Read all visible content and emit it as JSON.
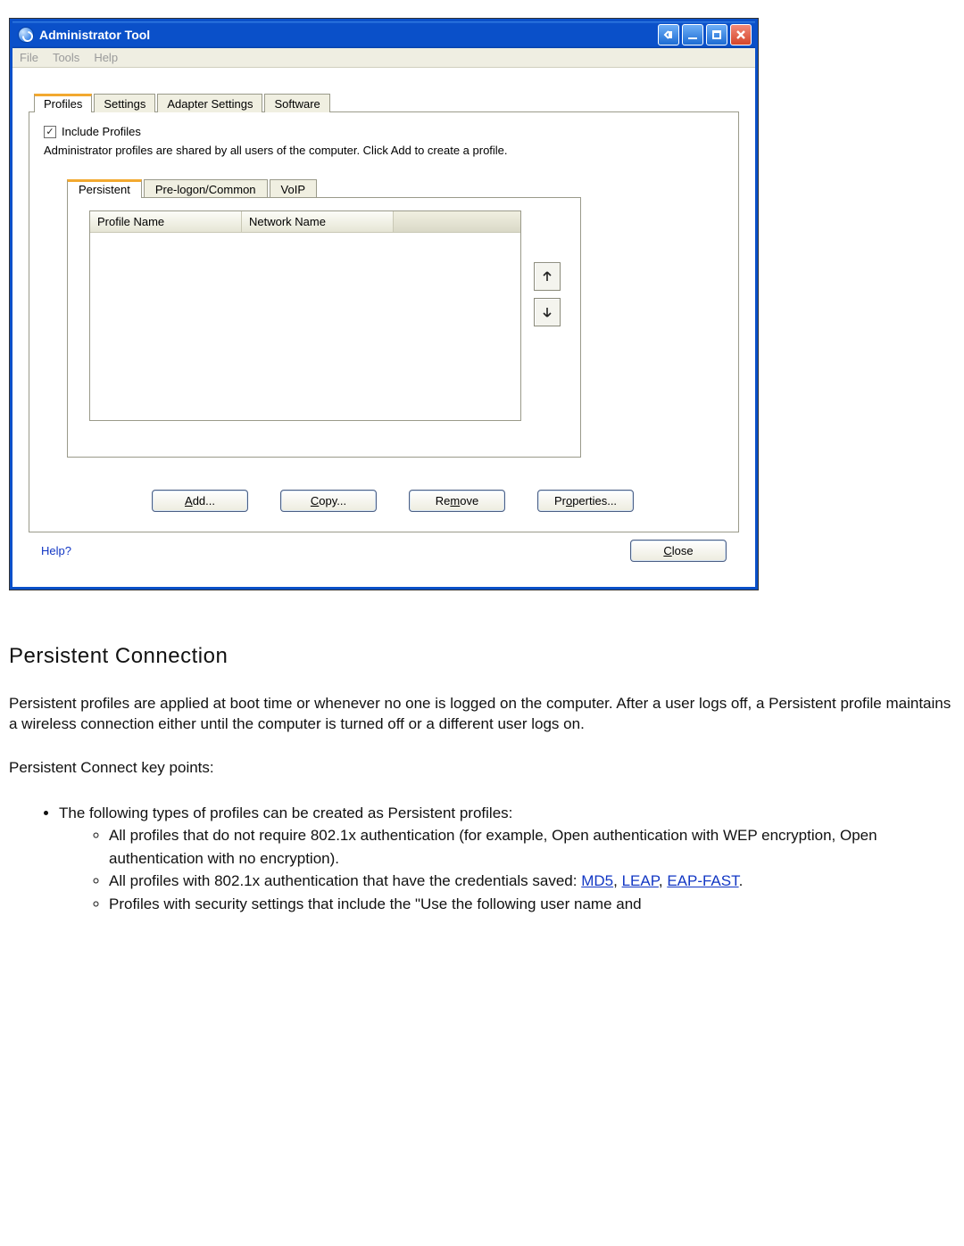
{
  "window": {
    "title": "Administrator Tool",
    "menubar": [
      "File",
      "Tools",
      "Help"
    ]
  },
  "tabs": {
    "items": [
      "Profiles",
      "Settings",
      "Adapter Settings",
      "Software"
    ],
    "active": "Profiles"
  },
  "profiles_panel": {
    "include_checkbox_label": "Include Profiles",
    "include_checked": true,
    "description": "Administrator profiles are shared by all users of the computer. Click Add to create a profile.",
    "inner_tabs": [
      "Persistent",
      "Pre-logon/Common",
      "VoIP"
    ],
    "inner_active": "Persistent",
    "columns": [
      "Profile Name",
      "Network Name"
    ],
    "rows": []
  },
  "buttons": {
    "add": "Add...",
    "copy": "Copy...",
    "remove": "Remove",
    "properties": "Properties...",
    "close": "Close",
    "help": "Help?"
  },
  "doc": {
    "heading": "Persistent Connection",
    "para1": "Persistent profiles are applied at boot time or whenever no one is logged on the computer. After a user logs off, a Persistent profile maintains a wireless connection either until the computer is turned off or a different user logs on.",
    "para2": "Persistent Connect key points:",
    "bullet1": "The following types of profiles can be created as Persistent profiles:",
    "sub1": "All profiles that do not require 802.1x authentication (for example, Open authentication with WEP encryption, Open authentication with no encryption).",
    "sub2a": "All profiles with 802.1x authentication that have the credentials saved: ",
    "sub2_links": {
      "md5": "MD5",
      "leap": "LEAP",
      "eapfast": "EAP-FAST"
    },
    "sub3": "Profiles with security settings that include the \"Use the following user name and"
  }
}
